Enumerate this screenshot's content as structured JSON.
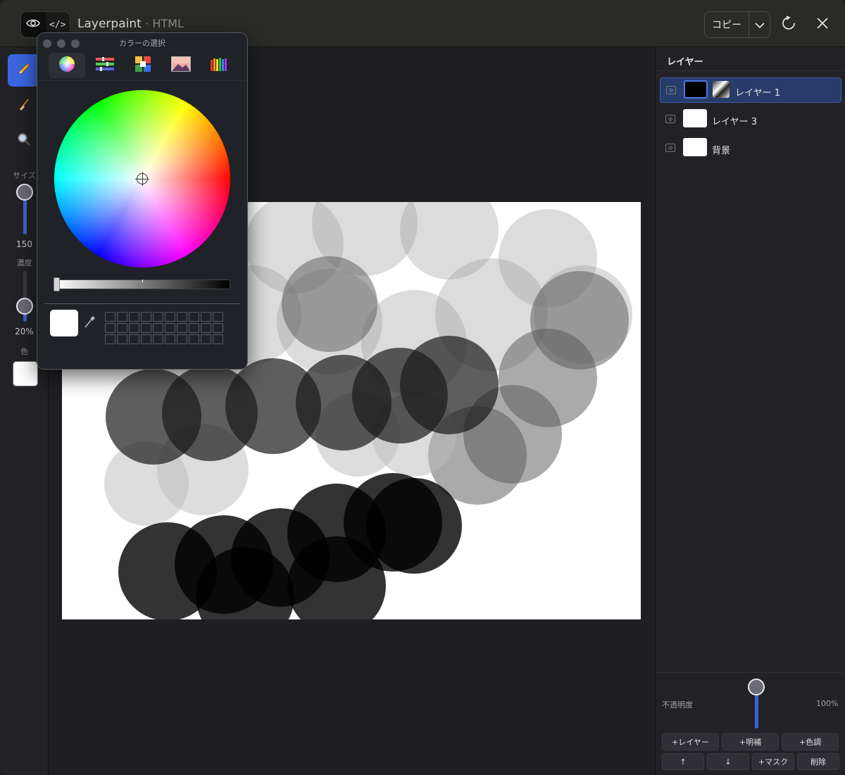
{
  "titlebar": {
    "title": "Layerpaint",
    "subtitle": "· HTML",
    "copy_label": "コピー"
  },
  "left_tools": {
    "size_label": "サイズ",
    "size_value": "150",
    "density_label": "濃度",
    "density_value": "20%",
    "color_label": "色",
    "current_color": "#ffffff"
  },
  "layers_panel": {
    "title": "レイヤー",
    "layers": [
      {
        "name": "レイヤー 1",
        "selected": true
      },
      {
        "name": "レイヤー 3",
        "selected": false
      },
      {
        "name": "背景",
        "selected": false
      }
    ],
    "opacity_label": "不透明度",
    "opacity_value": "100%",
    "buttons": {
      "add_layer": "+レイヤー",
      "add_brightness": "+明補",
      "add_tone": "+色調",
      "move_up": "↑",
      "move_down": "↓",
      "add_mask": "+マスク",
      "delete": "削除"
    }
  },
  "color_picker": {
    "title": "カラーの選択",
    "tabs": [
      "color-wheel",
      "color-sliders",
      "color-palettes",
      "image-palettes",
      "pencils"
    ],
    "selected_color": "#ffffff"
  }
}
